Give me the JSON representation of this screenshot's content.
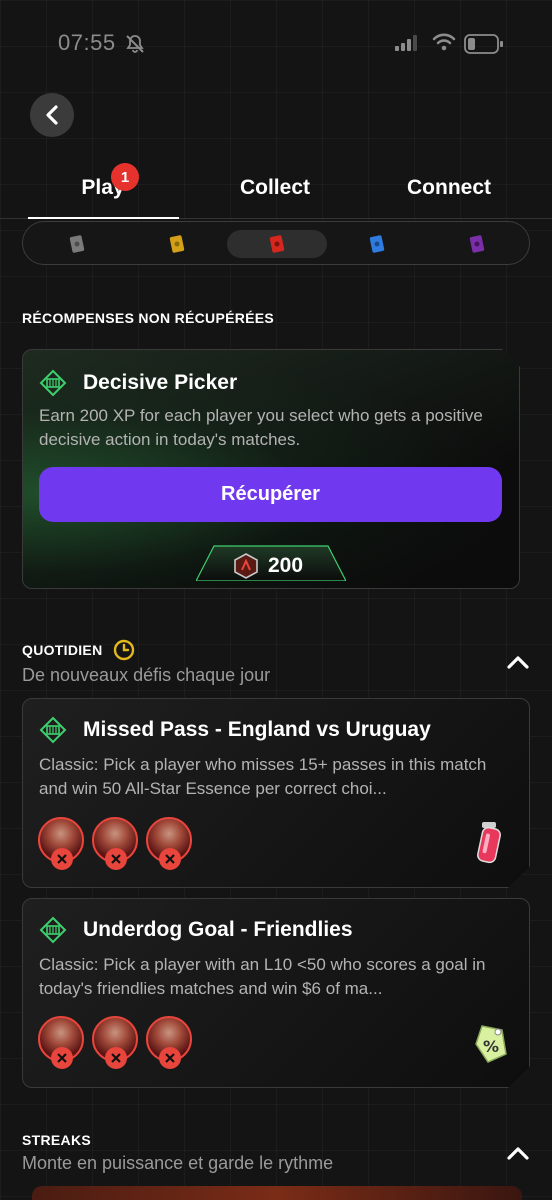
{
  "status_bar": {
    "time": "07:55"
  },
  "tabs": [
    {
      "label": "Play",
      "badge": "1",
      "active": true
    },
    {
      "label": "Collect"
    },
    {
      "label": "Connect"
    }
  ],
  "rarity_filter": {
    "items": [
      {
        "name": "common",
        "color": "#7a7a7a"
      },
      {
        "name": "limited",
        "color": "#d4a017"
      },
      {
        "name": "rare",
        "color": "#d7261e",
        "selected": true
      },
      {
        "name": "super-rare",
        "color": "#2f7be0"
      },
      {
        "name": "unique",
        "color": "#7a2ea8"
      }
    ]
  },
  "unclaimed": {
    "title": "RÉCOMPENSES NON RÉCUPÉRÉES",
    "card": {
      "title": "Decisive Picker",
      "description": "Earn 200 XP for each player you select who gets a positive decisive action in today's matches.",
      "button_label": "Récupérer",
      "xp_reward": "200"
    }
  },
  "daily": {
    "title": "QUOTIDIEN",
    "subtitle": "De nouveaux défis chaque jour",
    "challenges": [
      {
        "title": "Missed Pass - England vs Uruguay",
        "description": "Classic: Pick a player who misses 15+ passes in this match and win 50 All-Star Essence per correct choi..."
      },
      {
        "title": "Underdog Goal - Friendlies",
        "description": "Classic: Pick a player with an L10 <50 who scores a goal in today's friendlies matches and win $6 of ma..."
      }
    ]
  },
  "streaks": {
    "title": "STREAKS",
    "subtitle": "Monte en puissance et garde le rythme"
  },
  "colors": {
    "accent_purple": "#7139ef",
    "badge_red": "#e5322d",
    "icon_green": "#3ecf6e",
    "clock_yellow": "#e3b81e"
  }
}
